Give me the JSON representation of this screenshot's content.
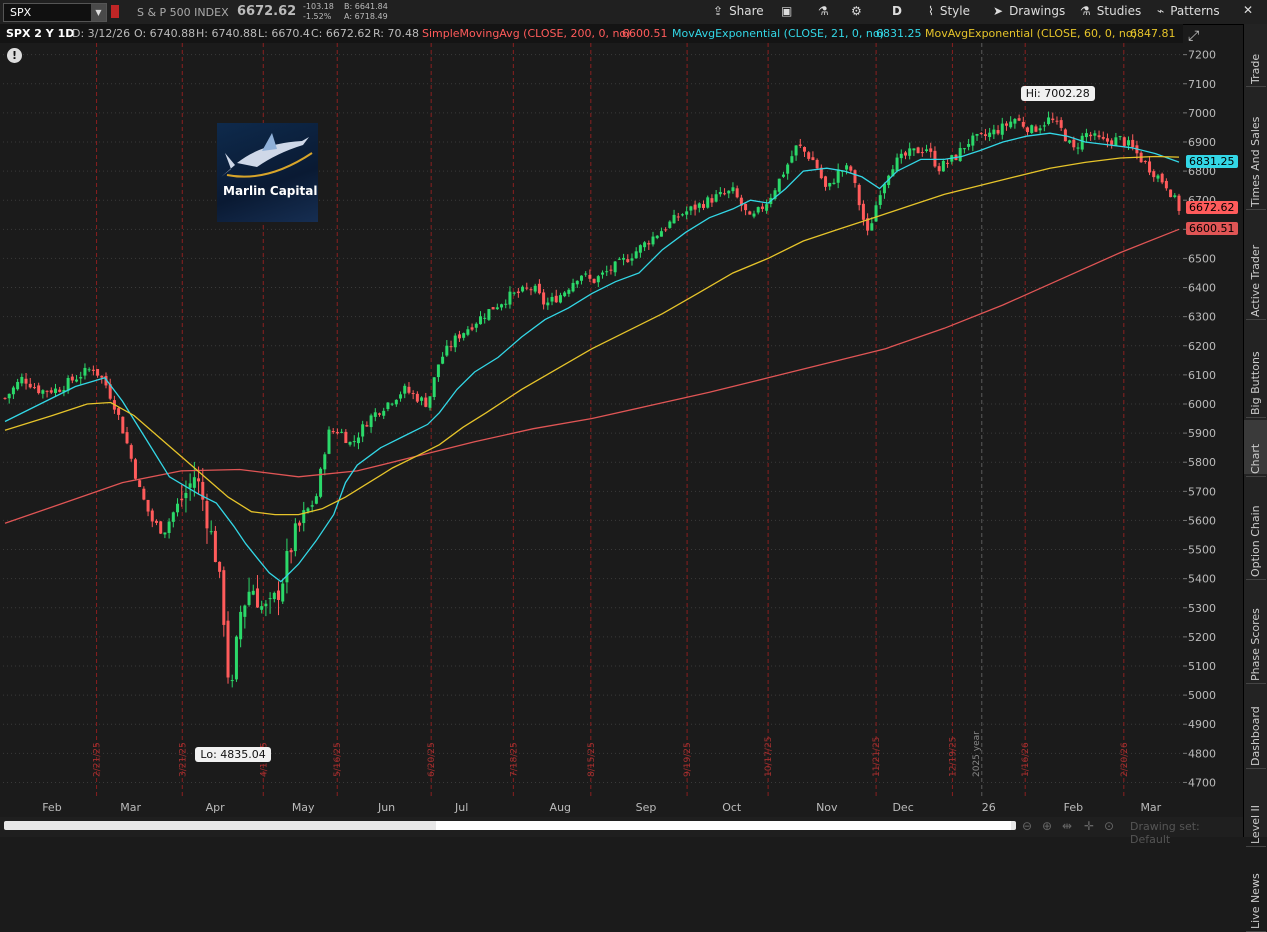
{
  "toolbar": {
    "symbol": "SPX",
    "description": "S & P 500 INDEX",
    "last": "6672.62",
    "change": "-103.18",
    "change_pct": "-1.52%",
    "bid": "B: 6641.84",
    "ask": "A: 6718.49",
    "share": "Share",
    "aggregation": "D",
    "style": "Style",
    "drawings": "Drawings",
    "studies": "Studies",
    "patterns": "Patterns"
  },
  "infobar": {
    "title": "SPX 2 Y 1D",
    "date": "D: 3/12/26",
    "open": "O: 6740.88",
    "high": "H: 6740.88",
    "low": "L: 6670.4",
    "close": "C: 6672.62",
    "range": "R: 70.48",
    "sma_label": "SimpleMovingAvg (CLOSE, 200, 0, no)",
    "sma_value": "6600.51",
    "ema21_label": "MovAvgExponential (CLOSE, 21, 0, no)",
    "ema21_value": "6831.25",
    "ema60_label": "MovAvgExponential (CLOSE, 60, 0, no)",
    "ema60_value": "6847.81"
  },
  "colors": {
    "candle_up": "#2bd96a",
    "candle_down": "#ff5b5b",
    "sma200": "#e05555",
    "ema21": "#33d7e6",
    "ema60": "#e6c42a",
    "event_line": "#8a1f1f",
    "grid": "#3a3a3a"
  },
  "logo_text": "Marlin Capital",
  "chart_data": {
    "type": "candlestick",
    "title": "",
    "ylim": [
      4650,
      7240
    ],
    "yticks": [
      4700,
      4800,
      4900,
      5000,
      5100,
      5200,
      5300,
      5400,
      5500,
      5600,
      5700,
      5800,
      5900,
      6000,
      6100,
      6200,
      6300,
      6400,
      6500,
      6600,
      6700,
      6800,
      6900,
      7000,
      7100,
      7200
    ],
    "months": [
      {
        "label": "Feb",
        "t": 0.04
      },
      {
        "label": "Mar",
        "t": 0.107
      },
      {
        "label": "Apr",
        "t": 0.179
      },
      {
        "label": "May",
        "t": 0.254
      },
      {
        "label": "Jun",
        "t": 0.325
      },
      {
        "label": "Jul",
        "t": 0.389
      },
      {
        "label": "Aug",
        "t": 0.473
      },
      {
        "label": "Sep",
        "t": 0.546
      },
      {
        "label": "Oct",
        "t": 0.619
      },
      {
        "label": "Nov",
        "t": 0.7
      },
      {
        "label": "Dec",
        "t": 0.765
      },
      {
        "label": "26",
        "t": 0.838
      },
      {
        "label": "Feb",
        "t": 0.91
      },
      {
        "label": "Mar",
        "t": 0.976
      }
    ],
    "events": [
      {
        "label": "2/21/25",
        "t": 0.078
      },
      {
        "label": "3/21/25",
        "t": 0.151
      },
      {
        "label": "4/17/25",
        "t": 0.22
      },
      {
        "label": "5/16/25",
        "t": 0.283
      },
      {
        "label": "6/20/25",
        "t": 0.363
      },
      {
        "label": "7/18/25",
        "t": 0.433
      },
      {
        "label": "8/15/25",
        "t": 0.499
      },
      {
        "label": "9/19/25",
        "t": 0.581
      },
      {
        "label": "10/17/25",
        "t": 0.65
      },
      {
        "label": "11/21/25",
        "t": 0.742
      },
      {
        "label": "12/19/25",
        "t": 0.807
      },
      {
        "label": "1/16/26",
        "t": 0.869
      },
      {
        "label": "2/20/26",
        "t": 0.953
      }
    ],
    "year_marker": {
      "label": "2025 year",
      "t": 0.832
    },
    "close_path": [
      [
        0,
        6020
      ],
      [
        0.015,
        6090
      ],
      [
        0.03,
        6045
      ],
      [
        0.045,
        6050
      ],
      [
        0.06,
        6090
      ],
      [
        0.075,
        6125
      ],
      [
        0.085,
        6075
      ],
      [
        0.095,
        5980
      ],
      [
        0.105,
        5850
      ],
      [
        0.115,
        5700
      ],
      [
        0.125,
        5600
      ],
      [
        0.135,
        5560
      ],
      [
        0.145,
        5640
      ],
      [
        0.155,
        5700
      ],
      [
        0.162,
        5760
      ],
      [
        0.17,
        5650
      ],
      [
        0.18,
        5470
      ],
      [
        0.187,
        5250
      ],
      [
        0.192,
        4960
      ],
      [
        0.2,
        5280
      ],
      [
        0.21,
        5380
      ],
      [
        0.22,
        5290
      ],
      [
        0.227,
        5300
      ],
      [
        0.235,
        5380
      ],
      [
        0.245,
        5530
      ],
      [
        0.255,
        5610
      ],
      [
        0.265,
        5680
      ],
      [
        0.275,
        5900
      ],
      [
        0.285,
        5910
      ],
      [
        0.295,
        5860
      ],
      [
        0.31,
        5950
      ],
      [
        0.325,
        6000
      ],
      [
        0.34,
        6050
      ],
      [
        0.36,
        6000
      ],
      [
        0.37,
        6150
      ],
      [
        0.385,
        6230
      ],
      [
        0.4,
        6280
      ],
      [
        0.415,
        6330
      ],
      [
        0.43,
        6370
      ],
      [
        0.45,
        6400
      ],
      [
        0.46,
        6340
      ],
      [
        0.475,
        6380
      ],
      [
        0.49,
        6450
      ],
      [
        0.5,
        6420
      ],
      [
        0.515,
        6460
      ],
      [
        0.53,
        6500
      ],
      [
        0.545,
        6550
      ],
      [
        0.56,
        6600
      ],
      [
        0.575,
        6650
      ],
      [
        0.59,
        6680
      ],
      [
        0.605,
        6710
      ],
      [
        0.62,
        6730
      ],
      [
        0.635,
        6630
      ],
      [
        0.65,
        6700
      ],
      [
        0.665,
        6810
      ],
      [
        0.675,
        6890
      ],
      [
        0.69,
        6830
      ],
      [
        0.7,
        6730
      ],
      [
        0.71,
        6800
      ],
      [
        0.72,
        6810
      ],
      [
        0.73,
        6650
      ],
      [
        0.735,
        6580
      ],
      [
        0.745,
        6730
      ],
      [
        0.755,
        6820
      ],
      [
        0.77,
        6860
      ],
      [
        0.785,
        6880
      ],
      [
        0.795,
        6810
      ],
      [
        0.81,
        6850
      ],
      [
        0.82,
        6900
      ],
      [
        0.835,
        6920
      ],
      [
        0.85,
        6950
      ],
      [
        0.86,
        6980
      ],
      [
        0.875,
        6940
      ],
      [
        0.89,
        6980
      ],
      [
        0.9,
        6940
      ],
      [
        0.91,
        6870
      ],
      [
        0.92,
        6930
      ],
      [
        0.935,
        6900
      ],
      [
        0.95,
        6910
      ],
      [
        0.96,
        6880
      ],
      [
        0.97,
        6830
      ],
      [
        0.98,
        6790
      ],
      [
        0.99,
        6750
      ],
      [
        1.0,
        6672
      ]
    ],
    "series": [
      {
        "name": "SimpleMovingAvg (CLOSE, 200, 0, no)",
        "values": [
          [
            0,
            5590
          ],
          [
            0.05,
            5660
          ],
          [
            0.1,
            5730
          ],
          [
            0.15,
            5770
          ],
          [
            0.2,
            5775
          ],
          [
            0.25,
            5750
          ],
          [
            0.3,
            5770
          ],
          [
            0.35,
            5820
          ],
          [
            0.4,
            5870
          ],
          [
            0.45,
            5915
          ],
          [
            0.5,
            5950
          ],
          [
            0.55,
            5995
          ],
          [
            0.6,
            6040
          ],
          [
            0.65,
            6090
          ],
          [
            0.7,
            6140
          ],
          [
            0.75,
            6190
          ],
          [
            0.8,
            6260
          ],
          [
            0.85,
            6340
          ],
          [
            0.9,
            6430
          ],
          [
            0.95,
            6520
          ],
          [
            1.0,
            6600
          ]
        ]
      },
      {
        "name": "MovAvgExponential (CLOSE, 21, 0, no)",
        "values": [
          [
            0,
            5940
          ],
          [
            0.03,
            6000
          ],
          [
            0.06,
            6060
          ],
          [
            0.085,
            6090
          ],
          [
            0.1,
            6010
          ],
          [
            0.12,
            5880
          ],
          [
            0.14,
            5750
          ],
          [
            0.165,
            5690
          ],
          [
            0.18,
            5660
          ],
          [
            0.195,
            5580
          ],
          [
            0.205,
            5520
          ],
          [
            0.215,
            5470
          ],
          [
            0.225,
            5420
          ],
          [
            0.235,
            5390
          ],
          [
            0.25,
            5450
          ],
          [
            0.265,
            5530
          ],
          [
            0.28,
            5620
          ],
          [
            0.29,
            5730
          ],
          [
            0.3,
            5790
          ],
          [
            0.32,
            5850
          ],
          [
            0.34,
            5890
          ],
          [
            0.36,
            5930
          ],
          [
            0.37,
            5970
          ],
          [
            0.385,
            6050
          ],
          [
            0.4,
            6110
          ],
          [
            0.42,
            6160
          ],
          [
            0.44,
            6230
          ],
          [
            0.46,
            6290
          ],
          [
            0.48,
            6330
          ],
          [
            0.5,
            6380
          ],
          [
            0.52,
            6420
          ],
          [
            0.54,
            6450
          ],
          [
            0.56,
            6530
          ],
          [
            0.58,
            6590
          ],
          [
            0.6,
            6640
          ],
          [
            0.62,
            6670
          ],
          [
            0.635,
            6700
          ],
          [
            0.65,
            6690
          ],
          [
            0.665,
            6740
          ],
          [
            0.68,
            6800
          ],
          [
            0.7,
            6810
          ],
          [
            0.715,
            6800
          ],
          [
            0.73,
            6780
          ],
          [
            0.745,
            6740
          ],
          [
            0.76,
            6800
          ],
          [
            0.78,
            6840
          ],
          [
            0.8,
            6840
          ],
          [
            0.815,
            6850
          ],
          [
            0.83,
            6870
          ],
          [
            0.85,
            6900
          ],
          [
            0.87,
            6920
          ],
          [
            0.89,
            6930
          ],
          [
            0.905,
            6920
          ],
          [
            0.92,
            6900
          ],
          [
            0.94,
            6890
          ],
          [
            0.96,
            6880
          ],
          [
            0.98,
            6860
          ],
          [
            1.0,
            6831
          ]
        ]
      },
      {
        "name": "MovAvgExponential (CLOSE, 60, 0, no)",
        "values": [
          [
            0,
            5910
          ],
          [
            0.04,
            5960
          ],
          [
            0.07,
            6000
          ],
          [
            0.09,
            6005
          ],
          [
            0.11,
            5960
          ],
          [
            0.13,
            5890
          ],
          [
            0.15,
            5820
          ],
          [
            0.17,
            5750
          ],
          [
            0.19,
            5680
          ],
          [
            0.21,
            5630
          ],
          [
            0.23,
            5620
          ],
          [
            0.25,
            5620
          ],
          [
            0.27,
            5640
          ],
          [
            0.29,
            5680
          ],
          [
            0.31,
            5730
          ],
          [
            0.33,
            5780
          ],
          [
            0.35,
            5820
          ],
          [
            0.37,
            5860
          ],
          [
            0.39,
            5920
          ],
          [
            0.41,
            5970
          ],
          [
            0.44,
            6050
          ],
          [
            0.47,
            6120
          ],
          [
            0.5,
            6190
          ],
          [
            0.53,
            6250
          ],
          [
            0.56,
            6310
          ],
          [
            0.59,
            6380
          ],
          [
            0.62,
            6450
          ],
          [
            0.65,
            6500
          ],
          [
            0.68,
            6560
          ],
          [
            0.71,
            6600
          ],
          [
            0.74,
            6640
          ],
          [
            0.77,
            6680
          ],
          [
            0.8,
            6720
          ],
          [
            0.83,
            6750
          ],
          [
            0.86,
            6780
          ],
          [
            0.89,
            6810
          ],
          [
            0.92,
            6830
          ],
          [
            0.95,
            6845
          ],
          [
            0.98,
            6850
          ],
          [
            1.0,
            6848
          ]
        ]
      }
    ],
    "annotations": [
      {
        "label": "Hi: 7002.28",
        "t": 0.895,
        "y": 7002.28
      },
      {
        "label": "Lo: 4835.04",
        "t": 0.192,
        "y": 4835.04
      }
    ],
    "price_tags": [
      {
        "value": "6831.25",
        "y": 6831.25,
        "kind": "ema21"
      },
      {
        "value": "6672.62",
        "y": 6672.62,
        "kind": "last"
      },
      {
        "value": "6600.51",
        "y": 6600.51,
        "kind": "sma200"
      }
    ]
  },
  "sidebar": [
    "Trade",
    "Times And Sales",
    "Active Trader",
    "Big Buttons",
    "Chart",
    "Option Chain",
    "Phase Scores",
    "Dashboard",
    "Level II",
    "Live News"
  ],
  "bottom": {
    "drawing_set": "Drawing set: Default"
  }
}
